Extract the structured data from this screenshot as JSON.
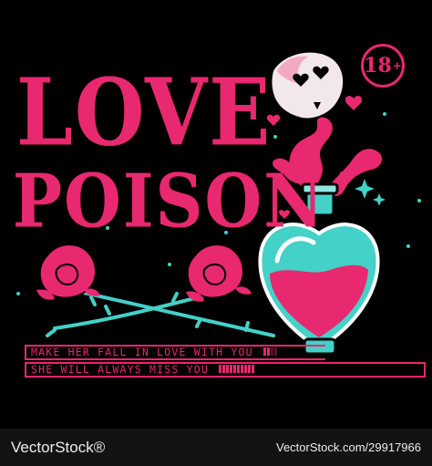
{
  "title": {
    "line1": "LOVE",
    "line2": "POISON"
  },
  "badge": {
    "number": "18",
    "sup": "+"
  },
  "messages": {
    "line1": "MAKE HER FALL IN LOVE WITH YOU",
    "line2": "SHE WILL ALWAYS MISS YOU"
  },
  "footer": {
    "brand": "VectorStock®",
    "image_id": "VectorStock.com/29917966"
  },
  "colors": {
    "pink": "#e8286f",
    "teal": "#43d1c8",
    "background": "#000000"
  }
}
